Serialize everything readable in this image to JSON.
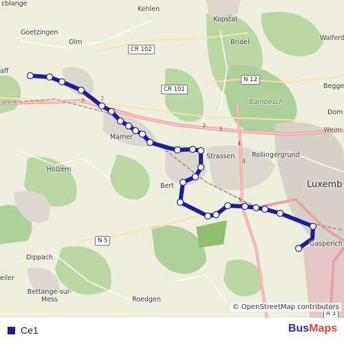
{
  "map": {
    "place_labels": [
      "ɛblange",
      "Kehlen",
      "Kopstal",
      "Goetzingen",
      "Olm",
      "Bridel",
      "Walferd",
      "aff",
      "Begge",
      "Bambesch",
      "Dom",
      "Weim",
      "Mamer",
      "Strassen",
      "Rollingergrund",
      "Holzem",
      "Luxemb",
      "Bert",
      "Gasperich",
      "Dippach",
      "eiler",
      "Bettange-sur-Mess",
      "Roedgen"
    ],
    "road_shields": [
      "CR 102",
      "CR 101",
      "N 12",
      "N 5",
      "A 3"
    ],
    "road_numbers": [
      "2",
      "3",
      "3",
      "4",
      "4",
      "5",
      "2"
    ],
    "attribution": "© OpenStreetMap contributors"
  },
  "route": {
    "name": "Ce1",
    "color": "#1c1c9c",
    "stop_count": 26
  },
  "brand": {
    "part1": "Bus",
    "part2": "Maps"
  }
}
